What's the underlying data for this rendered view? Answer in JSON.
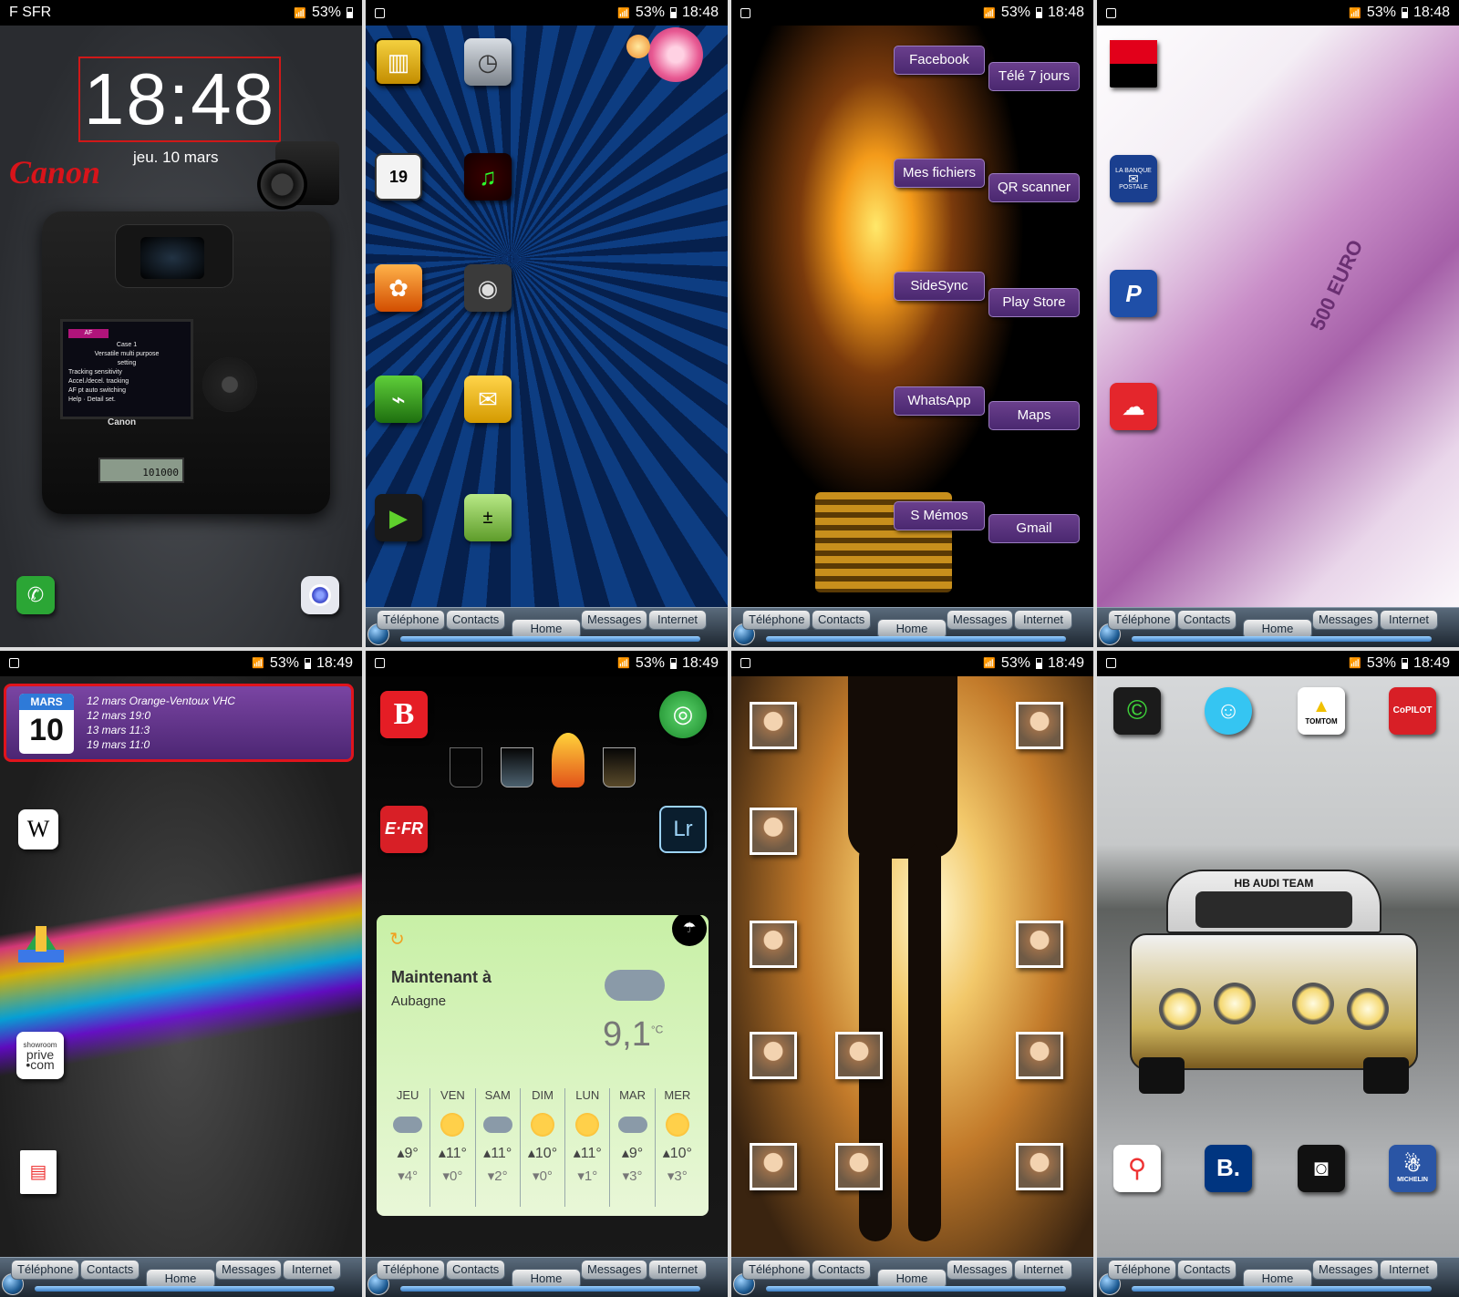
{
  "screens": [
    {
      "status": {
        "carrier": "F SFR",
        "battery": "53%",
        "time": ""
      },
      "lock": {
        "clock": "18:48",
        "date": "jeu. 10 mars",
        "brand": "Canon",
        "lcd_lines": [
          "Case 1",
          "Versatile multi purpose",
          "setting",
          "Tracking sensitivity",
          "Accel./decel. tracking",
          "AF pt auto switching",
          "Help",
          "Detail set."
        ],
        "body_brand": "Canon",
        "counter": "101000"
      }
    },
    {
      "status": {
        "carrier": "",
        "battery": "53%",
        "time": "18:48"
      },
      "calendar_day": "19"
    },
    {
      "status": {
        "carrier": "",
        "battery": "53%",
        "time": "18:48"
      },
      "shortcuts": [
        "Facebook",
        "Télé 7 jours",
        "Mes fichiers",
        "QR scanner",
        "SideSync",
        "Play Store",
        "WhatsApp",
        "Maps",
        "S Mémos",
        "Gmail"
      ]
    },
    {
      "status": {
        "carrier": "",
        "battery": "53%",
        "time": "18:48"
      },
      "labanque": [
        "LA BANQUE",
        "POSTALE"
      ],
      "banknote_label": "500 EURO"
    },
    {
      "status": {
        "carrier": "",
        "battery": "53%",
        "time": "18:49"
      },
      "calendar_widget": {
        "month": "MARS",
        "day": "10",
        "events": [
          "12 mars Orange-Ventoux VHC",
          "12 mars 19:0",
          "13 mars 11:3",
          "19 mars 11:0"
        ]
      },
      "apps": {
        "wiki": "W",
        "showroom": [
          "showroom",
          "prive",
          "•com"
        ]
      }
    },
    {
      "status": {
        "carrier": "",
        "battery": "53%",
        "time": "18:49"
      },
      "apps": {
        "efr": "E·FR",
        "lr": "Lr",
        "b": "B"
      },
      "weather": {
        "title": "Maintenant à",
        "city": "Aubagne",
        "temp": "9,1",
        "unit": "°C",
        "days": [
          {
            "d": "JEU",
            "hi": "9°",
            "lo": "4°",
            "icon": "cloud"
          },
          {
            "d": "VEN",
            "hi": "11°",
            "lo": "0°",
            "icon": "sun"
          },
          {
            "d": "SAM",
            "hi": "11°",
            "lo": "2°",
            "icon": "cloud"
          },
          {
            "d": "DIM",
            "hi": "10°",
            "lo": "0°",
            "icon": "sun"
          },
          {
            "d": "LUN",
            "hi": "11°",
            "lo": "1°",
            "icon": "sun"
          },
          {
            "d": "MAR",
            "hi": "9°",
            "lo": "3°",
            "icon": "cloud"
          },
          {
            "d": "MER",
            "hi": "10°",
            "lo": "3°",
            "icon": "sun"
          }
        ]
      }
    },
    {
      "status": {
        "carrier": "",
        "battery": "53%",
        "time": "18:49"
      }
    },
    {
      "status": {
        "carrier": "",
        "battery": "53%",
        "time": "18:49"
      },
      "apps": {
        "copilot": "CoPILOT",
        "tomtom": "TOMTOM",
        "booking": "B.",
        "michelin": "MICHELIN"
      },
      "car_banner": "HB AUDI TEAM"
    }
  ],
  "dock": {
    "phone": "Téléphone",
    "contacts": "Contacts",
    "home": "Home",
    "messages": "Messages",
    "internet": "Internet"
  },
  "colors": {
    "accent_purple": "#5b3680",
    "red": "#e31c1c",
    "status_bg": "#000000"
  }
}
